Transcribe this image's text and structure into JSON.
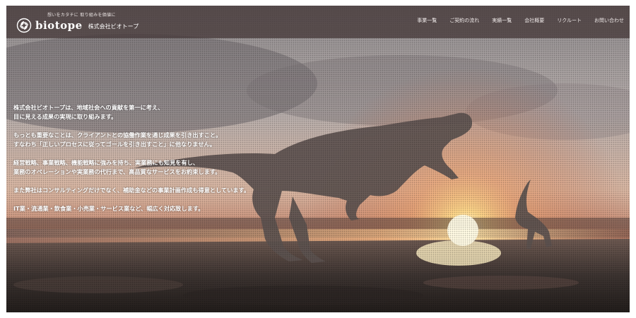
{
  "header": {
    "tagline": "想いをカタチに 取り組みを価値に",
    "brand": "biotope",
    "company": "株式会社ビオトープ",
    "logo_icon": "leaf-emblem-icon"
  },
  "nav": {
    "items": [
      {
        "label": "事業一覧"
      },
      {
        "label": "ご契約の流れ"
      },
      {
        "label": "実績一覧"
      },
      {
        "label": "会社概要"
      },
      {
        "label": "リクルート"
      },
      {
        "label": "お問い合わせ"
      }
    ]
  },
  "hero": {
    "paragraphs": [
      {
        "lines": [
          "株式会社ビオトープは、地域社会への貢献を第一に考え、",
          "目に見える成果の実現に取り組みます。"
        ]
      },
      {
        "lines": [
          "もっとも重要なことは、クライアントとの協働作業を通じ成果を引き出すこと。",
          "すなわち「正しいプロセスに従ってゴールを引き出すこと」に他なりません。"
        ]
      },
      {
        "lines": [
          "経営戦略、事業戦略、機能戦略に強みを持ち、実業務にも知見を有し、",
          "業務のオペレーションや実業務の代行まで、高品質なサービスをお約束します。"
        ]
      },
      {
        "lines": [
          "また弊社はコンサルティングだけでなく、補助金などの事業計画作成も得意としています。"
        ]
      },
      {
        "lines": [
          "IT業・流通業・飲食業・小売業・サービス業など、幅広く対応致します。"
        ]
      }
    ],
    "background": "dinosaur-sunset-photo"
  },
  "colors": {
    "header_bg": "#463a3a",
    "text": "#ffffff",
    "sun": "#ffe9b0"
  }
}
